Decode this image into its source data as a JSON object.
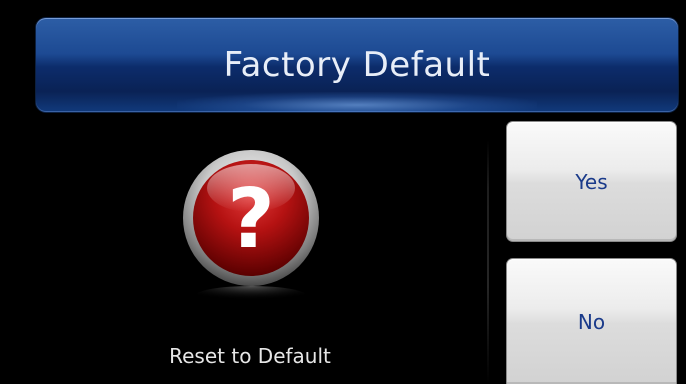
{
  "dialog": {
    "title": "Factory Default",
    "caption": "Reset to Default",
    "icon": "question-icon",
    "buttons": {
      "yes_label": "Yes",
      "no_label": "No"
    },
    "colors": {
      "title_bar": "#1d4a93",
      "icon_red": "#b01010",
      "button_text": "#1a3a8a",
      "background": "#000000"
    }
  }
}
